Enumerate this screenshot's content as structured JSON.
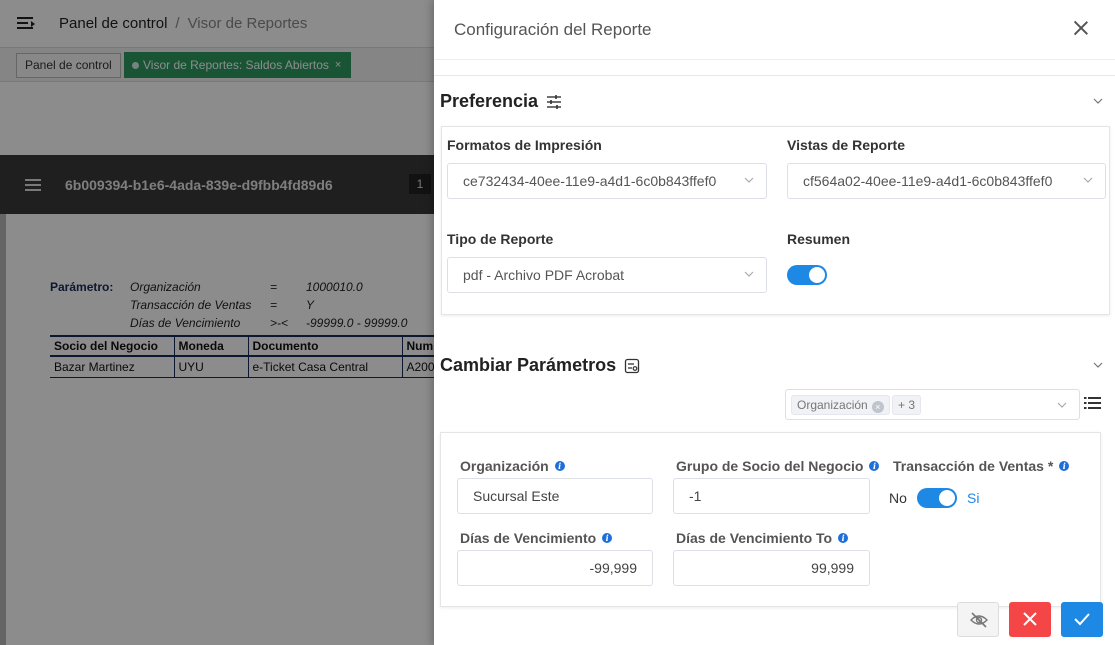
{
  "topbar": {
    "crumb_home": "Panel de control",
    "crumb_separator": "/",
    "crumb_current": "Visor de Reportes"
  },
  "tabs": {
    "tab_home": "Panel de control",
    "tab_report": "Visor de Reportes: Saldos Abiertos",
    "tab_close": "×"
  },
  "doc_header": {
    "doc_id": "6b009394-b1e6-4ada-839e-d9fbb4fd89d6",
    "page": "1"
  },
  "report": {
    "param_label": "Parámetro:",
    "params": [
      {
        "name": "Organización",
        "op": "=",
        "value": "1000010.0"
      },
      {
        "name": "Transacción de Ventas",
        "op": "=",
        "value": "Y"
      },
      {
        "name": "Días de Vencimiento",
        "op": ">-<",
        "value": "-99999.0 - 99999.0"
      }
    ],
    "columns": [
      "Socio del Negocio",
      "Moneda",
      "Documento",
      "Num"
    ],
    "rows": [
      [
        "Bazar Martinez",
        "UYU",
        "e-Ticket Casa Central",
        "A200"
      ]
    ]
  },
  "drawer": {
    "title": "Configuración del Reporte",
    "preferences": {
      "title": "Preferencia",
      "print_format_label": "Formatos de Impresión",
      "print_format_value": "ce732434-40ee-11e9-a4d1-6c0b843ffef0",
      "report_view_label": "Vistas de Reporte",
      "report_view_value": "cf564a02-40ee-11e9-a4d1-6c0b843ffef0",
      "report_type_label": "Tipo de Reporte",
      "report_type_value": "pdf - Archivo PDF Acrobat",
      "summary_label": "Resumen",
      "summary_on": true
    },
    "params": {
      "title": "Cambiar Parámetros",
      "chip_org": "Organización",
      "chip_more": "+ 3",
      "org_label": "Organización",
      "org_value": "Sucursal Este",
      "bp_group_label": "Grupo de Socio del Negocio",
      "bp_group_value": "-1",
      "sales_tx_label": "Transacción de Ventas",
      "required_mark": "*",
      "sales_tx_no": "No",
      "sales_tx_yes": "Si",
      "sales_tx_on": true,
      "due_days_label": "Días de Vencimiento",
      "due_days_value": "-99,999",
      "due_days_to_label": "Días de Vencimiento To",
      "due_days_to_value": "99,999"
    }
  },
  "colors": {
    "primary": "#1e88e5",
    "danger": "#f44646",
    "tab_green": "#2e9b62"
  }
}
